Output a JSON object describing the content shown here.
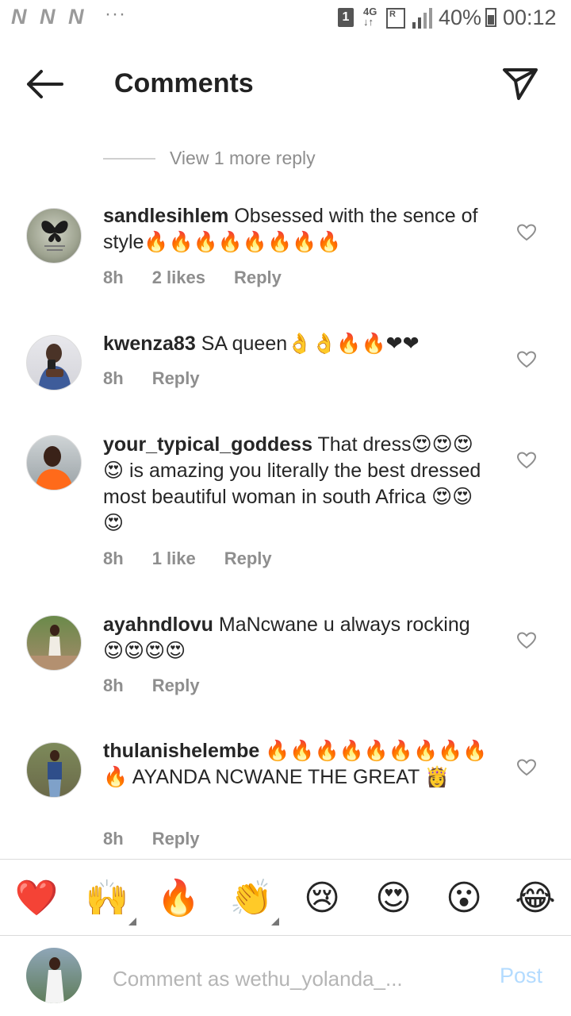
{
  "status_bar": {
    "carrier_marks": [
      "N",
      "N",
      "N"
    ],
    "dots": "···",
    "sim_badge": "1",
    "network": "4G",
    "roaming": "R",
    "battery": "40%",
    "time": "00:12"
  },
  "header": {
    "title": "Comments",
    "back_icon": "arrow-left-icon",
    "share_icon": "paper-plane-icon"
  },
  "view_more": "View 1 more reply",
  "comments": [
    {
      "user": "sandlesihlem",
      "text": "Obsessed with the sence of style🔥🔥🔥🔥🔥🔥🔥🔥",
      "time": "8h",
      "likes": "2 likes",
      "reply": "Reply"
    },
    {
      "user": "kwenza83",
      "text": "SA queen👌👌🔥🔥❤❤",
      "time": "8h",
      "likes": "",
      "reply": "Reply"
    },
    {
      "user": "your_typical_goddess",
      "text": "That dress😍😍😍😍 is amazing you literally the best dressed  most beautiful woman in south Africa 😍😍😍",
      "time": "8h",
      "likes": "1 like",
      "reply": "Reply"
    },
    {
      "user": "ayahndlovu",
      "text": "MaNcwane u always rocking 😍😍😍😍",
      "time": "8h",
      "likes": "",
      "reply": "Reply"
    },
    {
      "user": "thulanishelembe",
      "text": "🔥🔥🔥🔥🔥🔥🔥🔥🔥🔥 AYANDA NCWANE THE GREAT 👸",
      "time": "8h",
      "likes": "",
      "reply": "Reply"
    }
  ],
  "reactions": [
    "❤️",
    "🙌",
    "🔥",
    "👏",
    "😢",
    "😍",
    "😮",
    "😂"
  ],
  "composer": {
    "placeholder": "Comment as wethu_yolanda_...",
    "post_label": "Post"
  },
  "colors": {
    "text": "#262626",
    "muted": "#8e8e8e",
    "post_disabled": "#b3dbff",
    "divider": "#dbdbdb"
  }
}
